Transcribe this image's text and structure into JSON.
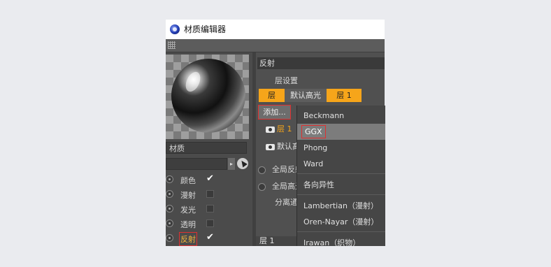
{
  "window": {
    "title": "材质编辑器"
  },
  "left": {
    "material_name": "材质",
    "channels": [
      {
        "label": "颜色",
        "checked": true
      },
      {
        "label": "漫射",
        "checked": false
      },
      {
        "label": "发光",
        "checked": false
      },
      {
        "label": "透明",
        "checked": false
      },
      {
        "label": "反射",
        "checked": true,
        "selected": true
      }
    ]
  },
  "right": {
    "section_title": "反射",
    "layer_settings_label": "层设置",
    "tabs": [
      "层",
      "默认高光",
      "层 1"
    ],
    "add_button": "添加...",
    "layers": [
      "层 1",
      "默认高光"
    ],
    "global_items": [
      "全局反射亮度",
      "全局高光亮度"
    ],
    "separate_label": "分离通道",
    "layer_header": "层 1"
  },
  "menu": {
    "items": [
      "Beckmann",
      "GGX",
      "Phong",
      "Ward",
      "各向异性",
      "Lambertian（漫射）",
      "Oren-Nayar（漫射）",
      "Irawan（织物）"
    ],
    "highlighted": "GGX"
  },
  "colors": {
    "accent": "#f6a51a",
    "highlight_outline": "#e03030"
  }
}
